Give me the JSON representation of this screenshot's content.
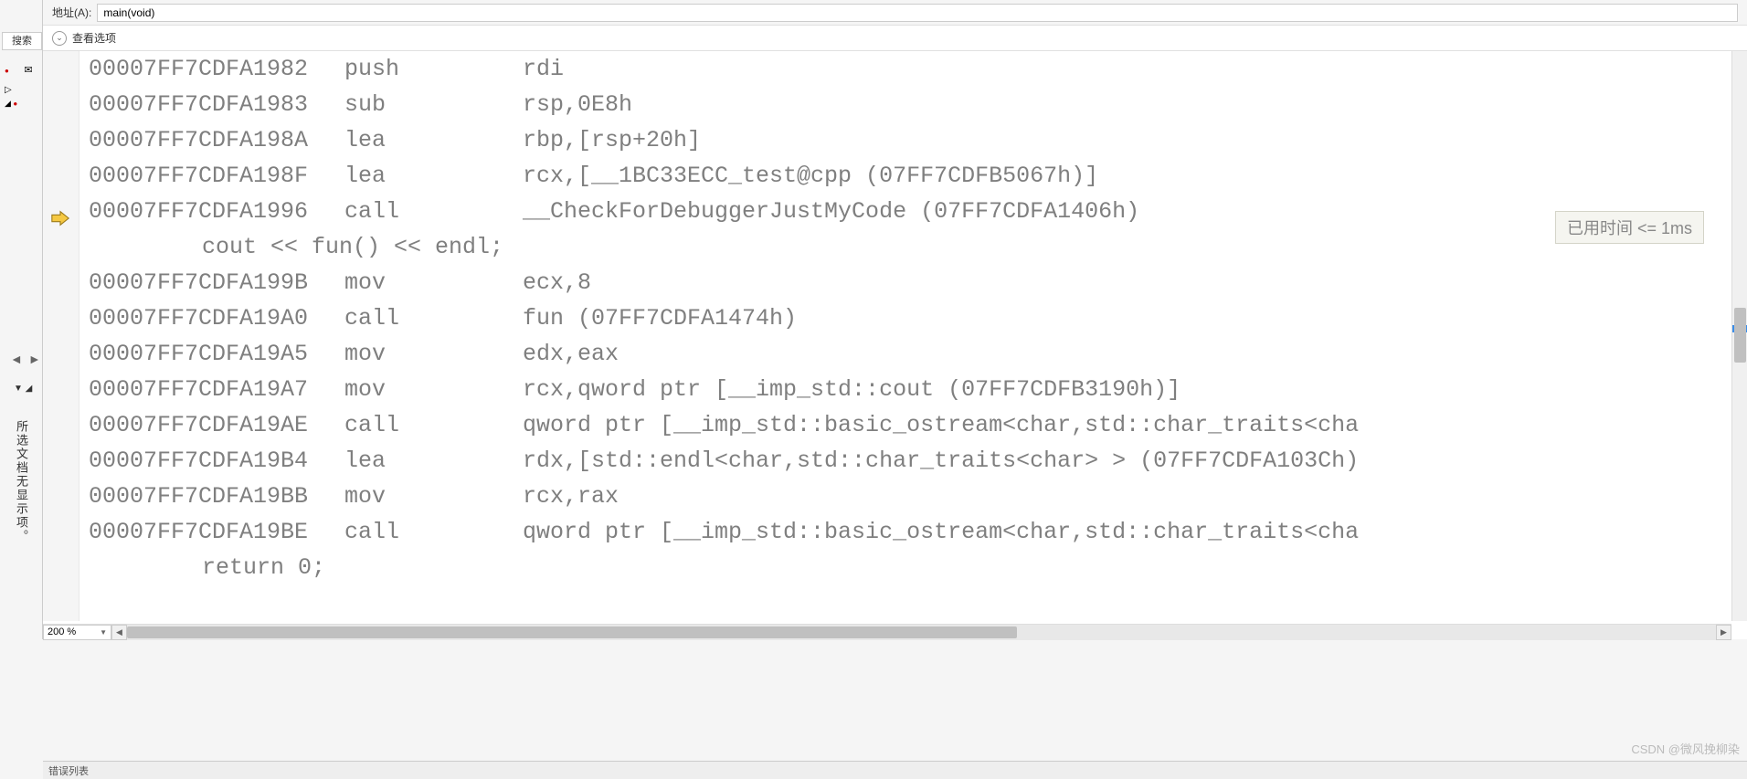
{
  "leftPanel": {
    "searchTabLabel": "搜索",
    "verticalMsg": "所选文档无显示项。"
  },
  "addressBar": {
    "label": "地址(A):",
    "value": "main(void)"
  },
  "optionsRow": {
    "label": "查看选项"
  },
  "disasm": {
    "lines": [
      {
        "addr": "00007FF7CDFA1982",
        "mnem": "push",
        "oper": "rdi"
      },
      {
        "addr": "00007FF7CDFA1983",
        "mnem": "sub",
        "oper": "rsp,0E8h"
      },
      {
        "addr": "00007FF7CDFA198A",
        "mnem": "lea",
        "oper": "rbp,[rsp+20h]"
      },
      {
        "addr": "00007FF7CDFA198F",
        "mnem": "lea",
        "oper": "rcx,[__1BC33ECC_test@cpp (07FF7CDFB5067h)]"
      },
      {
        "addr": "00007FF7CDFA1996",
        "mnem": "call",
        "oper": "__CheckForDebuggerJustMyCode (07FF7CDFA1406h)",
        "current": true
      },
      {
        "source": "    cout << fun() << endl;"
      },
      {
        "addr": "00007FF7CDFA199B",
        "mnem": "mov",
        "oper": "ecx,8"
      },
      {
        "addr": "00007FF7CDFA19A0",
        "mnem": "call",
        "oper": "fun (07FF7CDFA1474h)"
      },
      {
        "addr": "00007FF7CDFA19A5",
        "mnem": "mov",
        "oper": "edx,eax"
      },
      {
        "addr": "00007FF7CDFA19A7",
        "mnem": "mov",
        "oper": "rcx,qword ptr [__imp_std::cout (07FF7CDFB3190h)]"
      },
      {
        "addr": "00007FF7CDFA19AE",
        "mnem": "call",
        "oper": "qword ptr [__imp_std::basic_ostream<char,std::char_traits<cha"
      },
      {
        "addr": "00007FF7CDFA19B4",
        "mnem": "lea",
        "oper": "rdx,[std::endl<char,std::char_traits<char> > (07FF7CDFA103Ch)"
      },
      {
        "addr": "00007FF7CDFA19BB",
        "mnem": "mov",
        "oper": "rcx,rax"
      },
      {
        "addr": "00007FF7CDFA19BE",
        "mnem": "call",
        "oper": "qword ptr [__imp_std::basic_ostream<char,std::char_traits<cha"
      },
      {
        "source": "    return 0;"
      }
    ]
  },
  "perfTip": "已用时间 <= 1ms",
  "zoom": "200 %",
  "bottomTab": "错误列表",
  "watermark": "CSDN @微风挽柳染"
}
